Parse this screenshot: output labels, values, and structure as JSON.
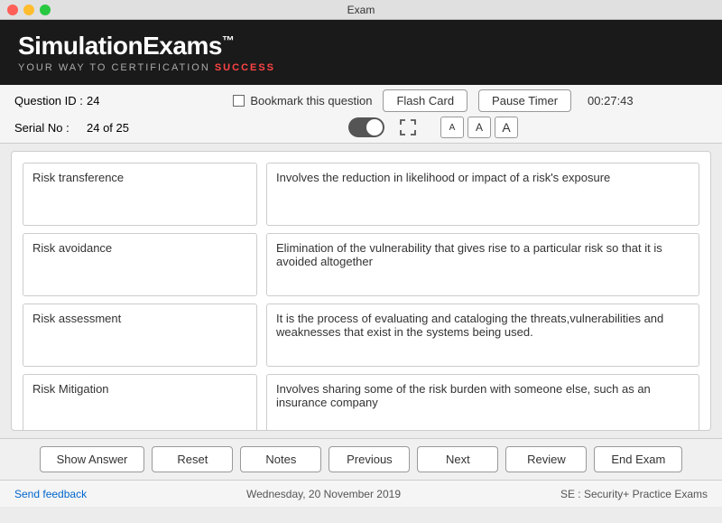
{
  "window": {
    "title": "Exam"
  },
  "brand": {
    "name": "SimulationExams",
    "tm": "™",
    "tagline_pre": "YOUR WAY TO CERTIFICATION ",
    "tagline_highlight": "SUCCESS"
  },
  "info": {
    "question_id_label": "Question ID :",
    "question_id_value": "24",
    "serial_no_label": "Serial No :",
    "serial_no_value": "24 of 25",
    "bookmark_label": "Bookmark this question",
    "flashcard_label": "Flash Card",
    "pause_label": "Pause Timer",
    "timer": "00:27:43"
  },
  "flashcards": [
    {
      "term": "Risk transference",
      "definition": "Involves the reduction in likelihood or impact of a risk's exposure"
    },
    {
      "term": "Risk avoidance",
      "definition": "Elimination of the vulnerability that gives rise to a particular risk so that it is avoided altogether"
    },
    {
      "term": "Risk assessment",
      "definition": "It is the process of evaluating and cataloging the threats,vulnerabilities and weaknesses that exist in the systems being used."
    },
    {
      "term": "Risk Mitigation",
      "definition": "Involves sharing some of the risk burden with someone else, such as an insurance company"
    }
  ],
  "buttons": {
    "show_answer": "Show Answer",
    "reset": "Reset",
    "notes": "Notes",
    "previous": "Previous",
    "next": "Next",
    "review": "Review",
    "end_exam": "End Exam"
  },
  "footer": {
    "feedback": "Send feedback",
    "date": "Wednesday, 20 November 2019",
    "exam": "SE : Security+ Practice Exams"
  },
  "font_btns": [
    "A",
    "A",
    "A"
  ]
}
